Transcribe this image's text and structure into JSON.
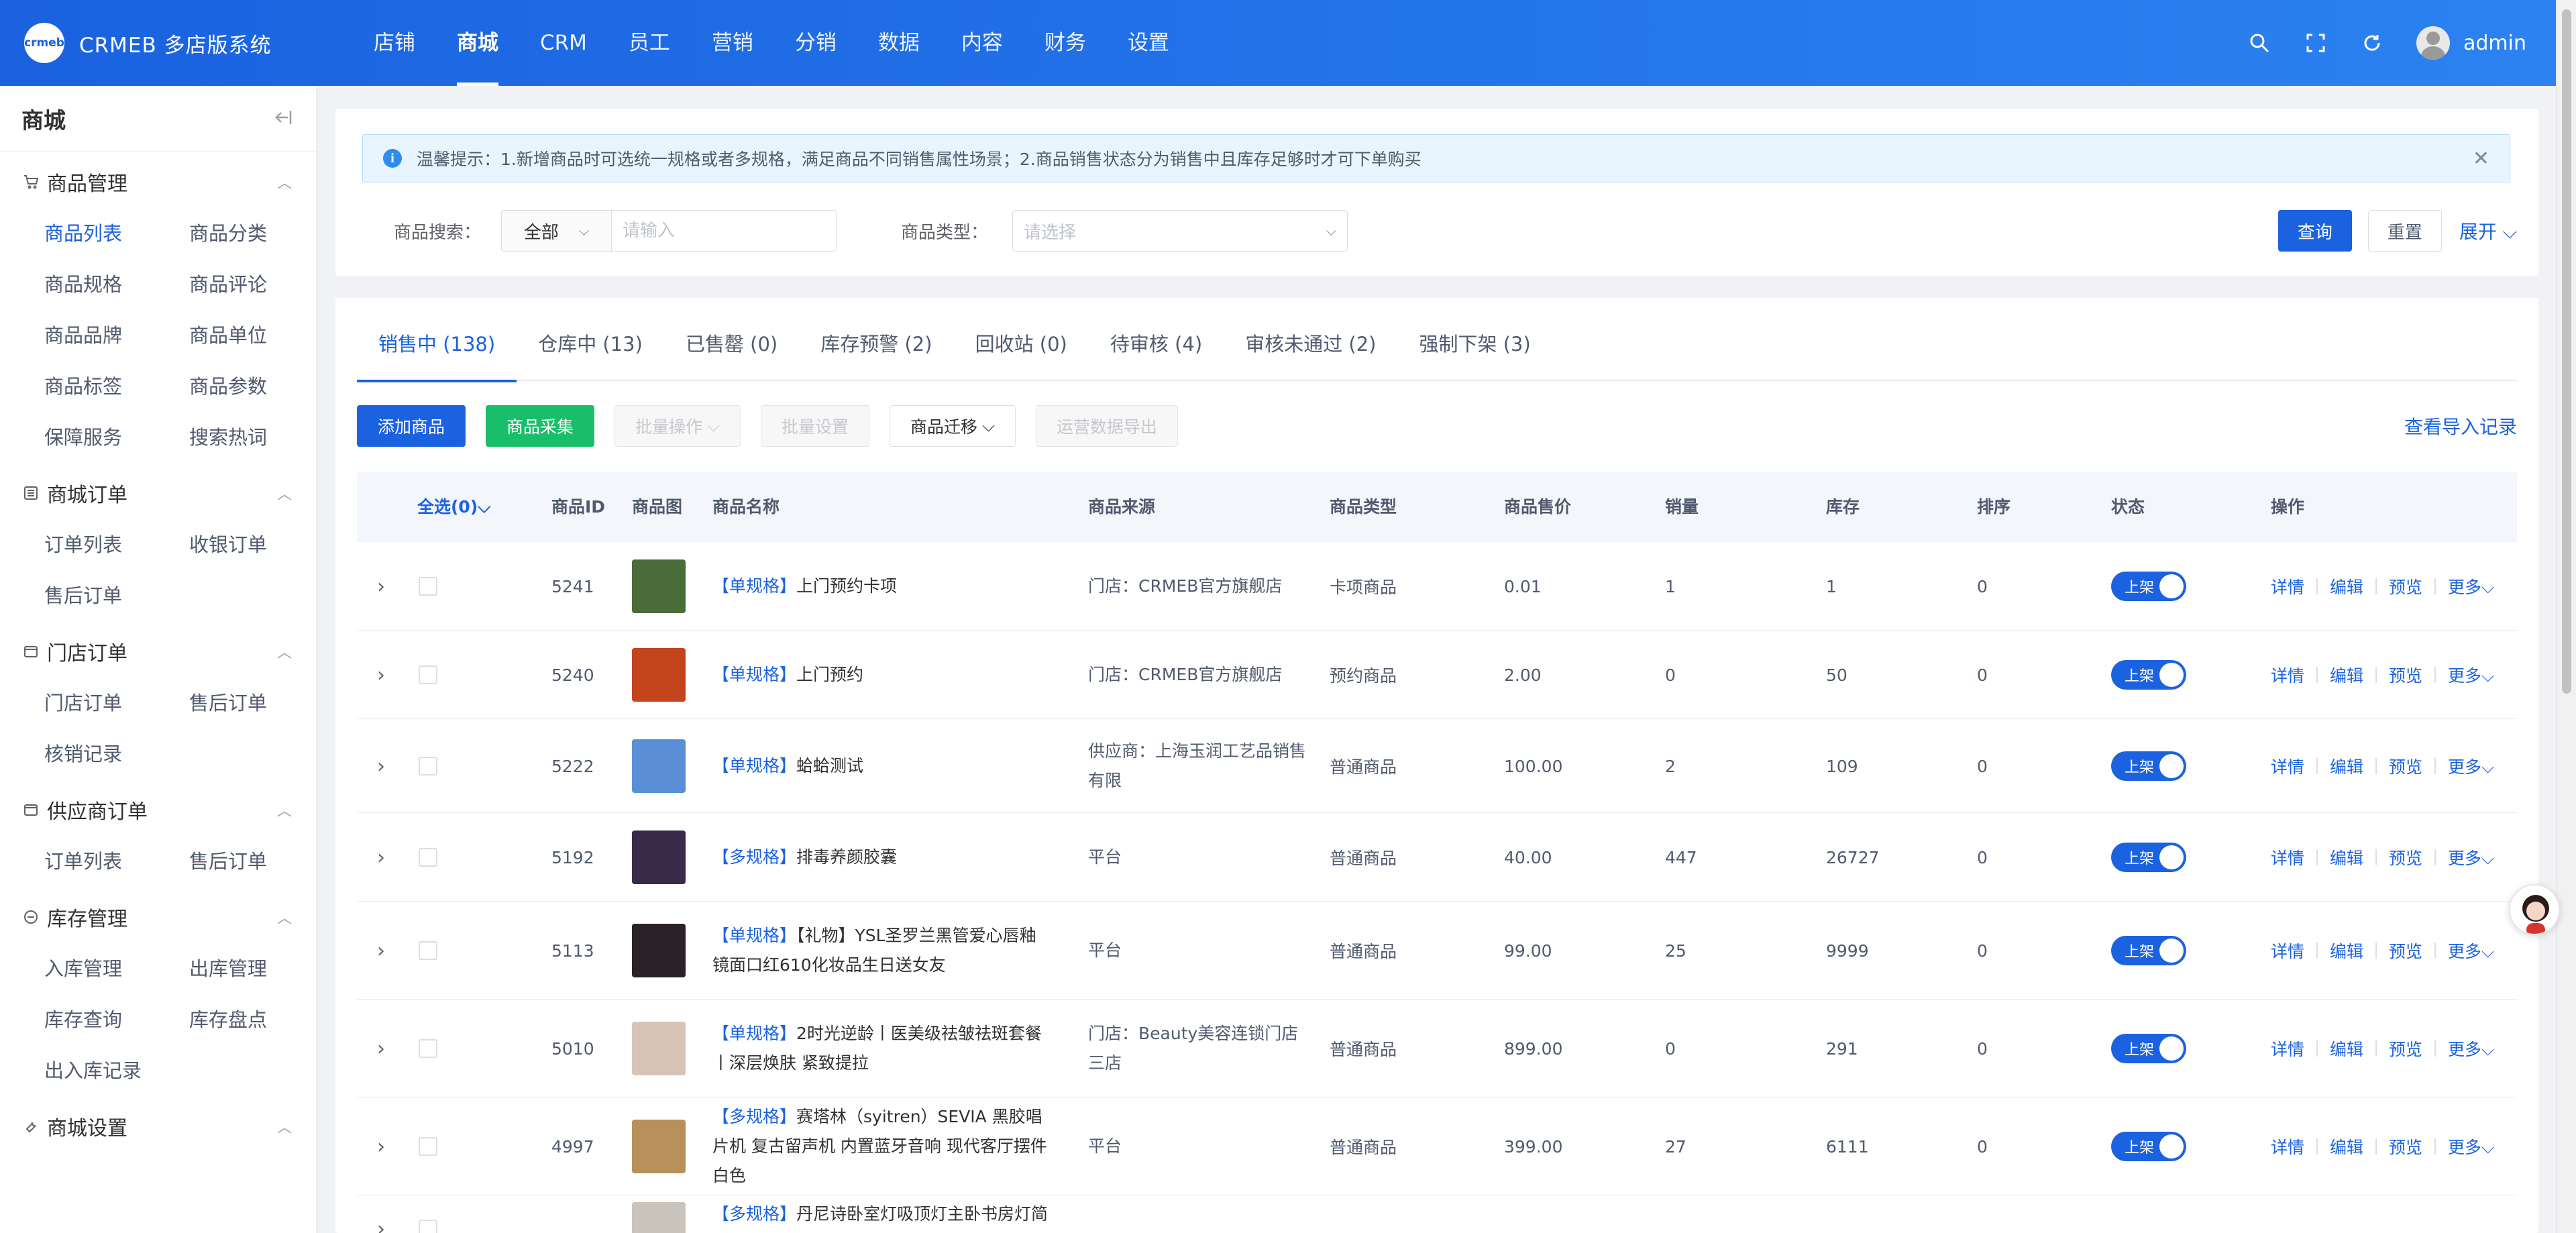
{
  "app": {
    "logo_text": "crmeb",
    "title": "CRMEB 多店版系统",
    "username": "admin",
    "top_nav": [
      {
        "label": "店铺"
      },
      {
        "label": "商城",
        "active": true
      },
      {
        "label": "CRM"
      },
      {
        "label": "员工"
      },
      {
        "label": "营销"
      },
      {
        "label": "分销"
      },
      {
        "label": "数据"
      },
      {
        "label": "内容"
      },
      {
        "label": "财务"
      },
      {
        "label": "设置"
      }
    ],
    "top_icons": [
      "search-icon",
      "fullscreen-icon",
      "refresh-icon"
    ]
  },
  "sidebar": {
    "title": "商城",
    "groups": [
      {
        "label": "商品管理",
        "icon": "cart-icon",
        "items": [
          "商品列表",
          "商品分类",
          "商品规格",
          "商品评论",
          "商品品牌",
          "商品单位",
          "商品标签",
          "商品参数",
          "保障服务",
          "搜索热词"
        ],
        "active": "商品列表"
      },
      {
        "label": "商城订单",
        "icon": "list-icon",
        "items": [
          "订单列表",
          "收银订单",
          "售后订单"
        ]
      },
      {
        "label": "门店订单",
        "icon": "store-icon",
        "items": [
          "门店订单",
          "售后订单",
          "核销记录"
        ]
      },
      {
        "label": "供应商订单",
        "icon": "store-icon",
        "items": [
          "订单列表",
          "售后订单"
        ]
      },
      {
        "label": "库存管理",
        "icon": "box-icon",
        "items": [
          "入库管理",
          "出库管理",
          "库存查询",
          "库存盘点",
          "出入库记录"
        ]
      },
      {
        "label": "商城设置",
        "icon": "wrench-icon",
        "items": []
      }
    ]
  },
  "notice": {
    "text": "温馨提示：1.新增商品时可选统一规格或者多规格，满足商品不同销售属性场景；2.商品销售状态分为销售中且库存足够时才可下单购买"
  },
  "search": {
    "label": "商品搜索：",
    "scope": "全部",
    "placeholder": "请输入",
    "type_label": "商品类型：",
    "type_placeholder": "请选择",
    "query_btn": "查询",
    "reset_btn": "重置",
    "expand": "展开"
  },
  "tabs": [
    {
      "label": "销售中 (138)",
      "active": true
    },
    {
      "label": "仓库中 (13)"
    },
    {
      "label": "已售罄 (0)"
    },
    {
      "label": "库存预警 (2)"
    },
    {
      "label": "回收站 (0)"
    },
    {
      "label": "待审核 (4)"
    },
    {
      "label": "审核未通过 (2)"
    },
    {
      "label": "强制下架 (3)"
    }
  ],
  "toolbar": {
    "add": "添加商品",
    "collect": "商品采集",
    "batch_ops": "批量操作",
    "batch_set": "批量设置",
    "migrate": "商品迁移",
    "export": "运营数据导出",
    "view_import": "查看导入记录"
  },
  "table": {
    "columns": {
      "select_all": "全选(0)",
      "id": "商品ID",
      "image": "商品图",
      "name": "商品名称",
      "source": "商品来源",
      "type": "商品类型",
      "price": "商品售价",
      "sales": "销量",
      "stock": "库存",
      "sort": "排序",
      "status": "状态",
      "actions": "操作"
    },
    "row_actions": {
      "detail": "详情",
      "edit": "编辑",
      "preview": "预览",
      "more": "更多"
    },
    "status_on": "上架",
    "rows": [
      {
        "id": "5241",
        "tag": "【单规格】",
        "name": "上门预约卡项",
        "source": "门店：CRMEB官方旗舰店",
        "type": "卡项商品",
        "price": "0.01",
        "sales": "1",
        "stock": "1",
        "sort": "0",
        "thumb_color": "#4a6b3a"
      },
      {
        "id": "5240",
        "tag": "【单规格】",
        "name": "上门预约",
        "source": "门店：CRMEB官方旗舰店",
        "type": "预约商品",
        "price": "2.00",
        "sales": "0",
        "stock": "50",
        "sort": "0",
        "thumb_color": "#c4441c"
      },
      {
        "id": "5222",
        "tag": "【单规格】",
        "name": "蛤蛤测试",
        "source": "供应商：上海玉润工艺品销售有限",
        "type": "普通商品",
        "price": "100.00",
        "sales": "2",
        "stock": "109",
        "sort": "0",
        "thumb_color": "#5a8fd6"
      },
      {
        "id": "5192",
        "tag": "【多规格】",
        "name": "排毒养颜胶囊",
        "source": "平台",
        "type": "普通商品",
        "price": "40.00",
        "sales": "447",
        "stock": "26727",
        "sort": "0",
        "thumb_color": "#3a2a4a"
      },
      {
        "id": "5113",
        "tag": "【单规格】",
        "name": "【礼物】YSL圣罗兰黑管爱心唇釉 镜面口红610化妆品生日送女友",
        "source": "平台",
        "type": "普通商品",
        "price": "99.00",
        "sales": "25",
        "stock": "9999",
        "sort": "0",
        "thumb_color": "#2a2226"
      },
      {
        "id": "5010",
        "tag": "【单规格】",
        "name": "2时光逆龄丨医美级祛皱祛斑套餐丨深层焕肤 紧致提拉",
        "source": "门店：Beauty美容连锁门店三店",
        "type": "普通商品",
        "price": "899.00",
        "sales": "0",
        "stock": "291",
        "sort": "0",
        "thumb_color": "#d8c4b6"
      },
      {
        "id": "4997",
        "tag": "【多规格】",
        "name": "赛塔林（syitren）SEVIA 黑胶唱片机 复古留声机 内置蓝牙音响 现代客厅摆件 白色",
        "source": "平台",
        "type": "普通商品",
        "price": "399.00",
        "sales": "27",
        "stock": "6111",
        "sort": "0",
        "thumb_color": "#b8905a"
      },
      {
        "id": "",
        "tag": "【多规格】",
        "name": "丹尼诗卧室灯吸顶灯主卧书房灯简约",
        "source": "",
        "type": "",
        "price": "",
        "sales": "",
        "stock": "",
        "sort": "",
        "thumb_color": "#c9c4bc"
      }
    ]
  },
  "colors": {
    "primary": "#1a62e0",
    "success": "#19be6b",
    "topbar_start": "#1a62e0",
    "topbar_end": "#2c82f0"
  }
}
